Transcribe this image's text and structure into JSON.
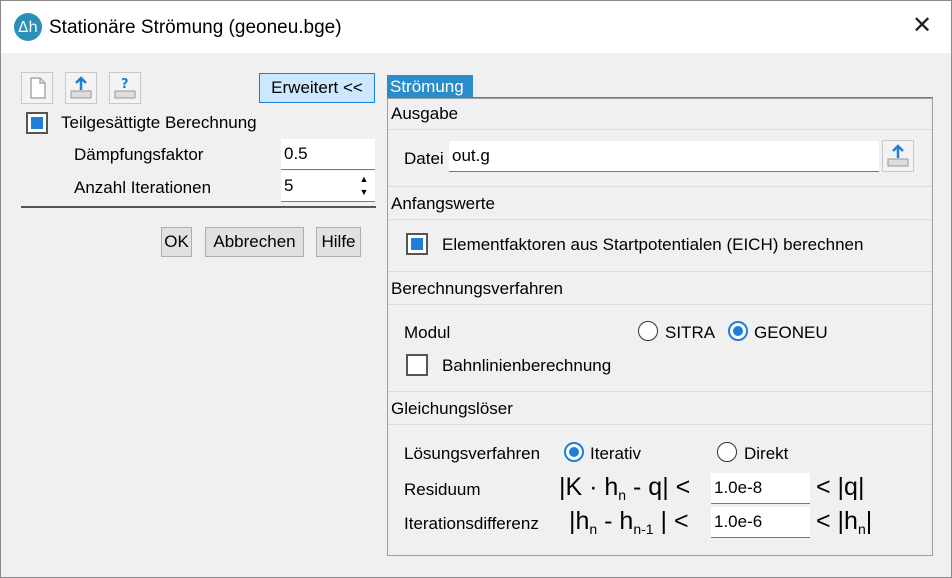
{
  "window": {
    "title": "Stationäre Strömung (geoneu.bge)",
    "app_icon_text": "Δh"
  },
  "toolbar": {
    "new_icon": "new-file-icon",
    "export_icon": "export-icon",
    "help_icon": "help-icon"
  },
  "left": {
    "advanced_button": "Erweitert <<",
    "partially_saturated": {
      "label": "Teilgesättigte Berechnung",
      "checked": true
    },
    "damping": {
      "label": "Dämpfungsfaktor",
      "value": "0.5"
    },
    "iterations": {
      "label": "Anzahl Iterationen",
      "value": "5"
    },
    "ok": "OK",
    "cancel": "Abbrechen",
    "help": "Hilfe"
  },
  "tab": {
    "label": "Strömung"
  },
  "output": {
    "header": "Ausgabe",
    "file_label": "Datei",
    "file_value": "out.g"
  },
  "initial": {
    "header": "Anfangswerte",
    "eich_label": "Elementfaktoren aus Startpotentialen (EICH) berechnen",
    "eich_checked": true
  },
  "method": {
    "header": "Berechnungsverfahren",
    "module_label": "Modul",
    "sitra": "SITRA",
    "geoneu": "GEONEU",
    "selected": "GEONEU",
    "streamline_label": "Bahnlinienberechnung",
    "streamline_checked": false
  },
  "solver": {
    "header": "Gleichungslöser",
    "method_label": "Lösungsverfahren",
    "iterative": "Iterativ",
    "direct": "Direkt",
    "selected": "Iterativ",
    "residual_label": "Residuum",
    "residual_value": "1.0e-8",
    "iterdiff_label": "Iterationsdifferenz",
    "iterdiff_value": "1.0e-6",
    "formula1_left": "|K · h",
    "formula1_sub": "n",
    "formula1_mid": " - q| <",
    "formula1_right": "< |q|",
    "formula2_left": "|h",
    "formula2_sub1": "n",
    "formula2_mid": " - h",
    "formula2_sub2": "n-1",
    "formula2_end": " | <",
    "formula2_right_a": "< |h",
    "formula2_right_sub": "n",
    "formula2_right_b": "|"
  }
}
